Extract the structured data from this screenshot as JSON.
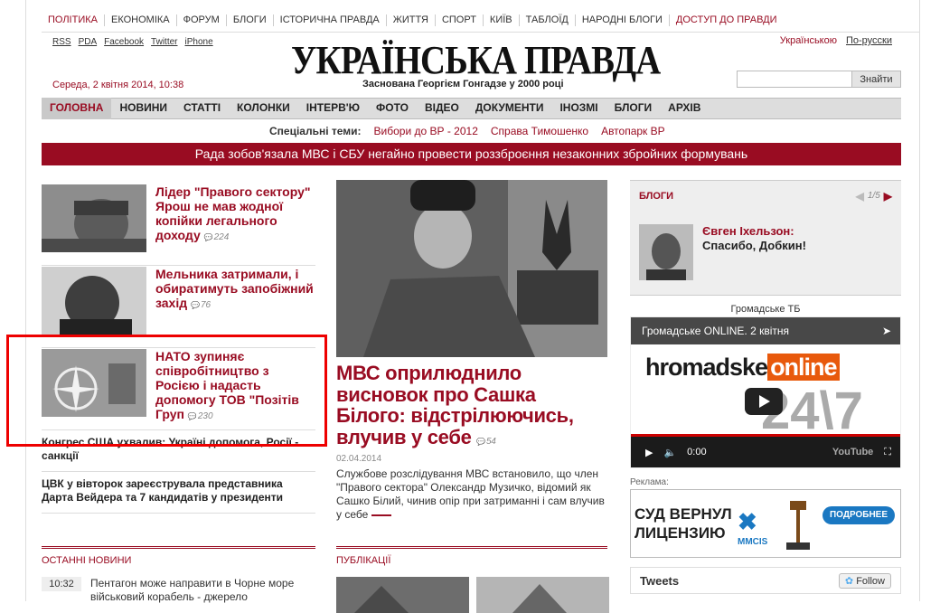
{
  "topnav": [
    "ПОЛІТИКА",
    "ЕКОНОМІКА",
    "ФОРУМ",
    "БЛОГИ",
    "ІСТОРИЧНА ПРАВДА",
    "ЖИТТЯ",
    "СПОРТ",
    "КИЇВ",
    "ТАБЛОЇД",
    "НАРОДНІ БЛОГИ",
    "ДОСТУП ДО ПРАВДИ"
  ],
  "links": [
    "RSS",
    "PDA",
    "Facebook",
    "Twitter",
    "iPhone"
  ],
  "langs": [
    "Українською",
    "По-русски"
  ],
  "logo": "УКРАЇНСЬКА ПРАВДА",
  "tagline": "Заснована Георгієм Гонгадзе у 2000 році",
  "date": "Середа, 2 квітня 2014, 10:38",
  "search": {
    "placeholder": "",
    "button": "Знайти"
  },
  "mainnav": [
    "ГОЛОВНА",
    "НОВИНИ",
    "СТАТТІ",
    "КОЛОНКИ",
    "ІНТЕРВ'Ю",
    "ФОТО",
    "ВІДЕО",
    "ДОКУМЕНТИ",
    "ІНОЗМІ",
    "БЛОГИ",
    "АРХІВ"
  ],
  "special": {
    "label": "Спеціальні теми:",
    "items": [
      "Вибори до ВР - 2012",
      "Справа Тимошенко",
      "Автопарк ВР"
    ]
  },
  "banner": "Рада зобов'язала МВС і СБУ негайно провести роззброєння незаконних збройних формувань",
  "left_news": [
    {
      "title": "Лідер \"Правого сектору\" Ярош не мав жодної копійки легального доходу",
      "comments": "224"
    },
    {
      "title": "Мельника затримали, і обиратимуть запобіжний захід",
      "comments": "76"
    },
    {
      "title": "НАТО зупиняє співробітництво з Росією і надасть допомогу ТОВ \"Позітів Груп",
      "comments": "230"
    }
  ],
  "left_small": [
    "Конгрес США ухвалив: Україні допомога, Росії - санкції",
    "ЦВК у вівторок зареєструвала представника Дарта Вейдера та 7 кандидатів у президенти"
  ],
  "hero": {
    "title": "МВС оприлюднило висновок про Сашка Білого: відстрілюючись, влучив у себе",
    "comments": "54",
    "date": "02.04.2014",
    "lead": "Службове розслідування МВС встановило, що член \"Правого сектора\" Олександр Музичко, відомий як Сашко Білий, чинив опір при затриманні і сам влучив у себе"
  },
  "blogs": {
    "title": "БЛОГИ",
    "pager": "1/5",
    "author": "Євген Іхельзон:",
    "post": "Спасибо, Добкин!"
  },
  "tv": {
    "label": "Громадське ТБ",
    "video_title": "Громадське ONLINE. 2 квітня",
    "logo_a": "hromadske",
    "logo_b": "online",
    "big": "24\\7",
    "time": "0:00",
    "yt": "YouTube"
  },
  "ad": {
    "label": "Реклама:",
    "line1": "СУД ВЕРНУЛ",
    "line2": "ЛИЦЕНЗИЮ",
    "brand": "MMCIS",
    "button": "ПОДРОБНЕЕ"
  },
  "tweets": {
    "title": "Tweets",
    "follow": "Follow"
  },
  "latest": {
    "head": "ОСТАННІ НОВИНИ",
    "time": "10:32",
    "text": "Пентагон може направити в Чорне море військовий корабель - джерело"
  },
  "publications": {
    "head": "ПУБЛІКАЦІЇ"
  }
}
